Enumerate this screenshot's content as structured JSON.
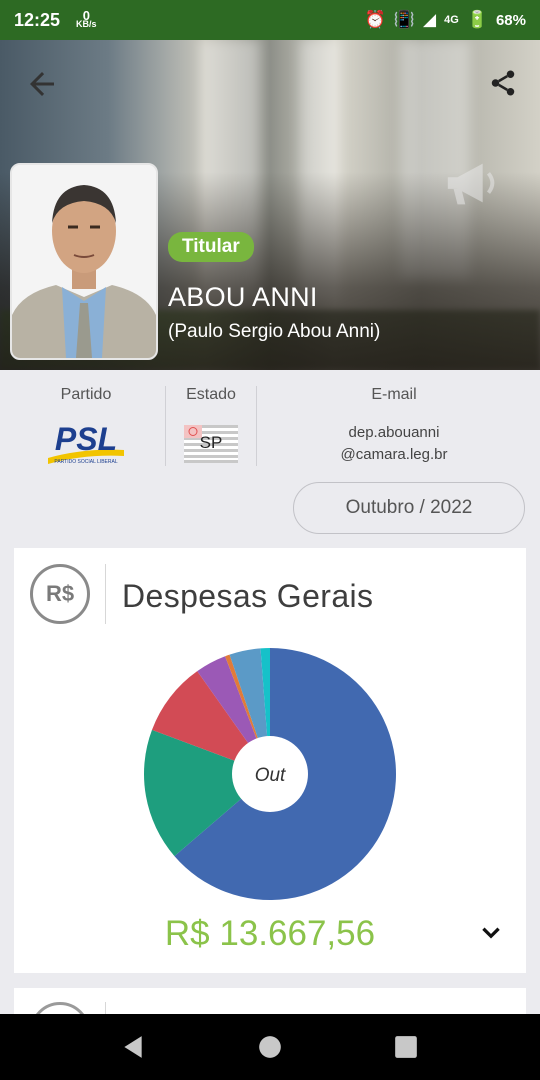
{
  "status_bar": {
    "time": "12:25",
    "net_speed_value": "0",
    "net_speed_unit": "KB/s",
    "network": "4G",
    "battery": "68%"
  },
  "header": {
    "badge": "Titular",
    "name": "ABOU ANNI",
    "full_name": "(Paulo Sergio Abou Anni)"
  },
  "info": {
    "party_label": "Partido",
    "party_logo_text": "PSL",
    "party_logo_subtext": "PARTIDO SOCIAL LIBERAL",
    "state_label": "Estado",
    "state_code": "SP",
    "email_label": "E-mail",
    "email_line1": "dep.abouanni",
    "email_line2": "@camara.leg.br"
  },
  "month_selector": "Outubro / 2022",
  "expenses_card": {
    "icon_text": "R$",
    "title": "Despesas Gerais",
    "total": "R$ 13.667,56"
  },
  "chart_data": {
    "type": "pie",
    "center_label": "Out",
    "slices": [
      {
        "value": 0.637,
        "color": "#4169b0"
      },
      {
        "value": 0.17,
        "color": "#1e9e7e"
      },
      {
        "value": 0.095,
        "color": "#d24b55"
      },
      {
        "value": 0.04,
        "color": "#9b59b6"
      },
      {
        "value": 0.006,
        "color": "#e07b39"
      },
      {
        "value": 0.04,
        "color": "#5b9ac7"
      },
      {
        "value": 0.012,
        "color": "#16c1c9"
      }
    ]
  },
  "colors": {
    "status_bar": "#2d6a23",
    "accent_green": "#79b63e",
    "total_green": "#8bc34a",
    "background": "#ebebef"
  }
}
